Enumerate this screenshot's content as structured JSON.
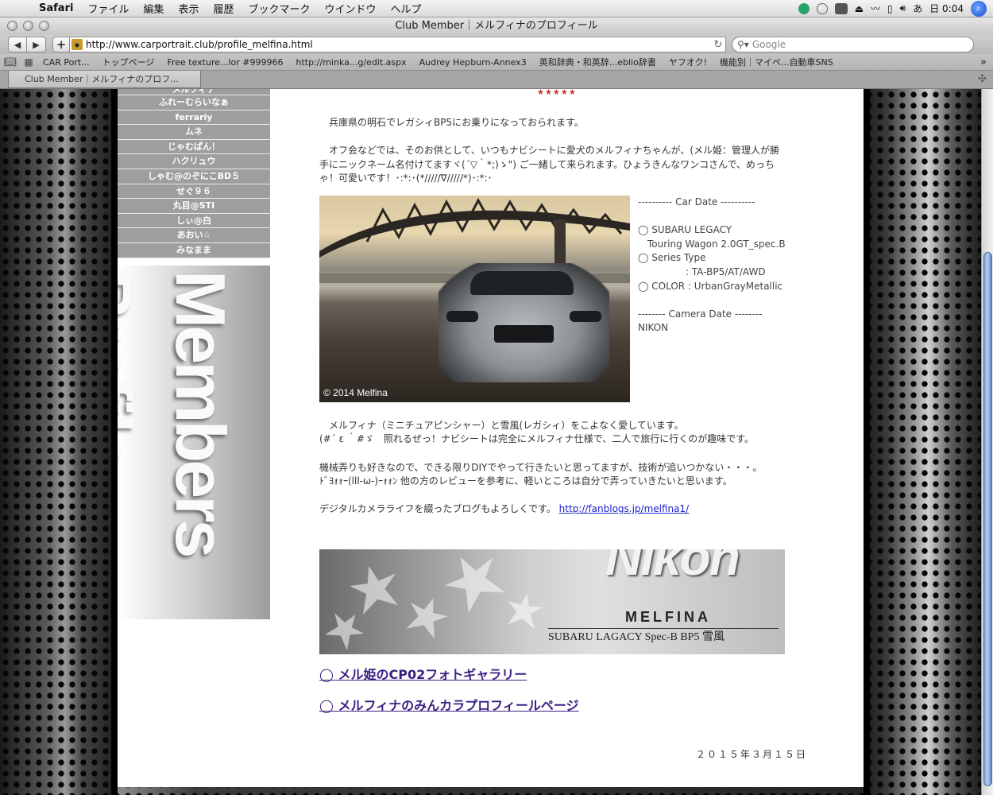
{
  "menubar": {
    "app": "Safari",
    "items": [
      "ファイル",
      "編集",
      "表示",
      "履歴",
      "ブックマーク",
      "ウインドウ",
      "ヘルプ"
    ],
    "input_mode": "あ",
    "clock": "日 0:04"
  },
  "window": {
    "title": "Club Member｜メルフィナのプロフィール"
  },
  "toolbar": {
    "url": "http://www.carportrait.club/profile_melfina.html",
    "search_placeholder": "Google"
  },
  "bookmarks": [
    "CAR Port...",
    "トップページ",
    "Free texture...lor #999966",
    "http://minka...g/edit.aspx",
    "Audrey Hepburn-Annex3",
    "英和辞典・和英辞...eblio辞書",
    "ヤフオク!",
    "機能別｜マイペ...自動車SNS"
  ],
  "tab": {
    "label": "Club Member｜メルフィナのプロフ..."
  },
  "sidebar": {
    "partial_item": "メルフィナ",
    "items": [
      "ふれーむらいなぁ",
      "ferrariy",
      "ムネ",
      "じゃむぱん！",
      "ハクリュウ",
      "しゃむ@のぞにこBD５",
      "せぐ９６",
      "丸目@STI",
      "しぃ@白",
      "あおい☆",
      "みなまま"
    ],
    "banner_text": "Members Profile"
  },
  "content": {
    "stars": "★★★★★",
    "intro": "　兵庫県の明石でレガシィBP5にお乗りになっておられます。",
    "offkai": "　オフ会などでは、そのお供として、いつもナビシートに愛犬のメルフィナちゃんが、(メル姫：管理人が勝手にニックネーム名付けてますヾ(´▽｀*;)ゝ\") ご一緒して来られます。ひょうきんなワンコさんで、めっちゃ！可愛いです！･:*:･(*/////∇/////*)･:*:･",
    "photo_copyright": "© 2014 Melfina",
    "car_data": [
      "---------- Car Date ----------",
      "",
      "◯ SUBARU LEGACY",
      "　Touring Wagon 2.0GT_spec.B",
      "◯ Series Type",
      "　　　　　: TA-BP5/AT/AWD",
      "◯ COLOR : UrbanGrayMetallic",
      "",
      "-------- Camera Date --------",
      "NIKON"
    ],
    "love_line1": "　メルフィナ（ミニチュアピンシャー）と雪風(レガシィ）をこよなく愛しています。",
    "love_line2": "(#´ ε ｀#ゞ　照れるぜっ！ナビシートは完全にメルフィナ仕様で、二人で旅行に行くのが趣味です。",
    "diy_line1": "機械弄りも好きなので、できる限りDIYでやって行きたいと思ってますが、技術が追いつかない・・・。",
    "diy_line2": "ﾄﾞﾖｫｫｰ(lll-ω-)ｰｫｫﾝ 他の方のレビューを参考に、軽いところは自分で弄っていきたいと思います。",
    "blog_text": "デジタルカメラライフを綴ったブログもよろしくです。",
    "blog_url": "http://fanblogs.jp/melfina1/",
    "banner": {
      "brand": "Nikon",
      "sub": "MELFINA",
      "sub2": "SUBARU LAGACY Spec-B BP5 雪風"
    },
    "link_gallery": "◯ メル姫のCP02フォトギャラリー",
    "link_minkara": "◯ メルフィナのみんカラプロフィールページ",
    "date": "２０１５年３月１５日"
  }
}
